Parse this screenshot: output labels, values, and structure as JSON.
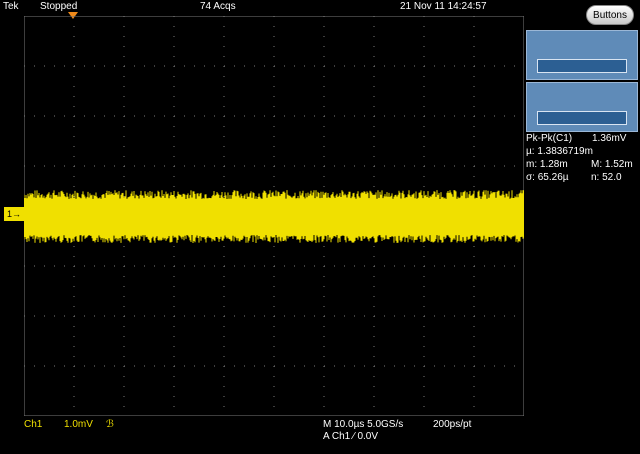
{
  "topbar": {
    "brand": "Tek",
    "run_state": "Stopped",
    "acquisitions": "74 Acqs",
    "datetime": "21 Nov 11 14:24:57"
  },
  "buttons_label": "Buttons",
  "channel_marker": "1",
  "measurements": {
    "pkpk_label": "Pk-Pk(C1)",
    "pkpk_value": "1.36mV",
    "mean": "µ: 1.3836719m",
    "min": "m: 1.28m",
    "max": "M: 1.52m",
    "sigma": "σ: 65.26µ",
    "n": "n: 52.0"
  },
  "bottombar": {
    "channel": "Ch1",
    "scale": "1.0mV",
    "bw_icon": "ℬ",
    "timebase": "M 10.0µs 5.0GS/s",
    "resolution": "200ps/pt",
    "trigger": "A  Ch1  ⁄  0.0V"
  },
  "colors": {
    "trace": "#f0e000",
    "background": "#000000",
    "panel_slot": "#5f8bb8",
    "trigger_marker": "#f08a1a"
  },
  "icons": {
    "trigger_position": "trigger-position-icon",
    "bandwidth_limit": "bandwidth-icon"
  }
}
